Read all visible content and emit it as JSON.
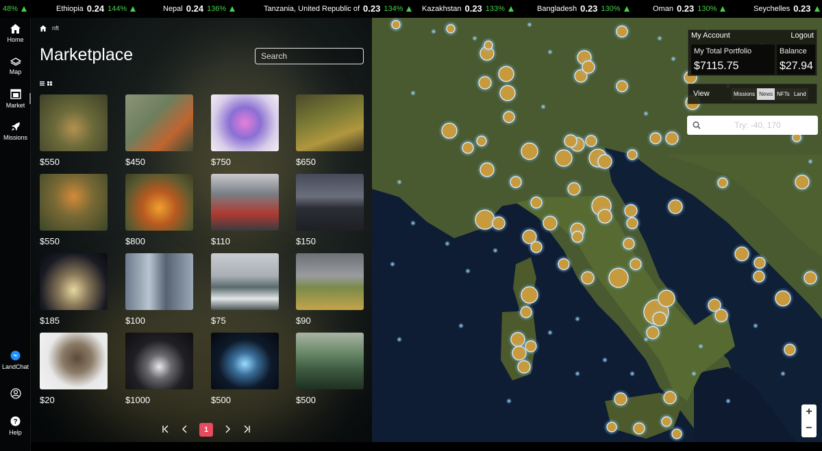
{
  "ticker": [
    {
      "name": "",
      "value": "",
      "pct": "48%"
    },
    {
      "name": "Ethiopia",
      "value": "0.24",
      "pct": "144%"
    },
    {
      "name": "Nepal",
      "value": "0.24",
      "pct": "136%"
    },
    {
      "name": "Tanzania, United Republic of",
      "value": "0.23",
      "pct": "134%"
    },
    {
      "name": "Kazakhstan",
      "value": "0.23",
      "pct": "133%"
    },
    {
      "name": "Bangladesh",
      "value": "0.23",
      "pct": "130%"
    },
    {
      "name": "Oman",
      "value": "0.23",
      "pct": "130%"
    },
    {
      "name": "Seychelles",
      "value": "0.23",
      "pct": "128"
    }
  ],
  "nav": {
    "home": "Home",
    "map": "Map",
    "market": "Market",
    "missions": "Missions",
    "landchat": "LandChat",
    "help": "Help"
  },
  "marketplace": {
    "breadcrumb": "nft",
    "title": "Marketplace",
    "search_placeholder": "Search",
    "prices": [
      "$550",
      "$450",
      "$750",
      "$650",
      "$550",
      "$800",
      "$110",
      "$150",
      "$185",
      "$100",
      "$75",
      "$90",
      "$20",
      "$1000",
      "$500",
      "$500"
    ],
    "pagination": {
      "current": "1"
    }
  },
  "account": {
    "heading": "My Account",
    "logout": "Logout",
    "portfolio_label": "My Total Portfolio",
    "portfolio_value": "$7115.75",
    "balance_label": "Balance",
    "balance_value": "$27.94"
  },
  "view": {
    "label": "View",
    "options": [
      "Missions",
      "News",
      "NFTs",
      "Land"
    ],
    "selected": "News"
  },
  "coordinates": {
    "placeholder": "Try: -40, 170"
  },
  "zoom": {
    "in": "+",
    "out": "−"
  },
  "colors": {
    "ticker_up": "#49d049",
    "page_current": "#e84a5f",
    "land_marker": "#c79a3e",
    "sea": "#0e1d33"
  }
}
